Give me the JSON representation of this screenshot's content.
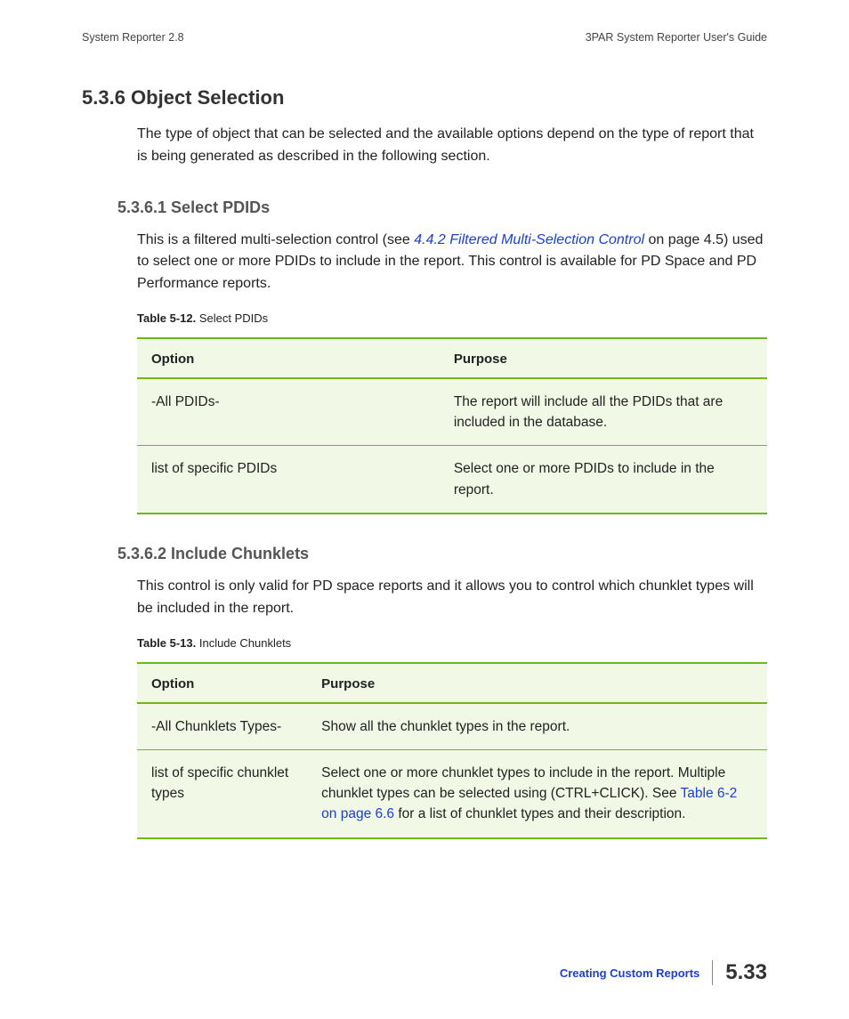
{
  "header": {
    "left": "System Reporter 2.8",
    "right": "3PAR System Reporter User's Guide"
  },
  "section": {
    "number_title": "5.3.6 Object Selection",
    "intro": "The type of object that can be selected and the available options depend on the type of report that is being generated as described in the following section."
  },
  "sub1": {
    "title": "5.3.6.1 Select PDIDs",
    "para_pre": "This is a filtered multi-selection control (see ",
    "link": "4.4.2 Filtered Multi-Selection Control",
    "para_post": " on page 4.5) used to select one or more PDIDs to include in the report. This control is available for PD Space and PD Performance reports.",
    "caption_label": "Table 5-12.",
    "caption_text": "  Select PDIDs",
    "th1": "Option",
    "th2": "Purpose",
    "rows": [
      {
        "option": "-All PDIDs-",
        "purpose": "The report will include all the PDIDs that are included in the database."
      },
      {
        "option": "list of specific PDIDs",
        "purpose": "Select one or more PDIDs to include in the report."
      }
    ]
  },
  "sub2": {
    "title": "5.3.6.2 Include Chunklets",
    "para": "This control is only valid for PD space reports and it allows you to control which chunklet types will be included in the report.",
    "caption_label": "Table 5-13.",
    "caption_text": "  Include Chunklets",
    "th1": "Option",
    "th2": "Purpose",
    "rows": [
      {
        "option": "-All Chunklets Types-",
        "purpose": "Show all the chunklet types in the report."
      },
      {
        "option": "list of specific chunklet types",
        "purpose_pre": "Select one or more chunklet types to include in the report. Multiple chunklet types can be selected using (CTRL+CLICK). See ",
        "link": "Table 6-2 on page 6.6",
        "purpose_post": " for a list of chunklet types and their description."
      }
    ]
  },
  "footer": {
    "chapter": "Creating Custom Reports",
    "page": "5.33"
  }
}
